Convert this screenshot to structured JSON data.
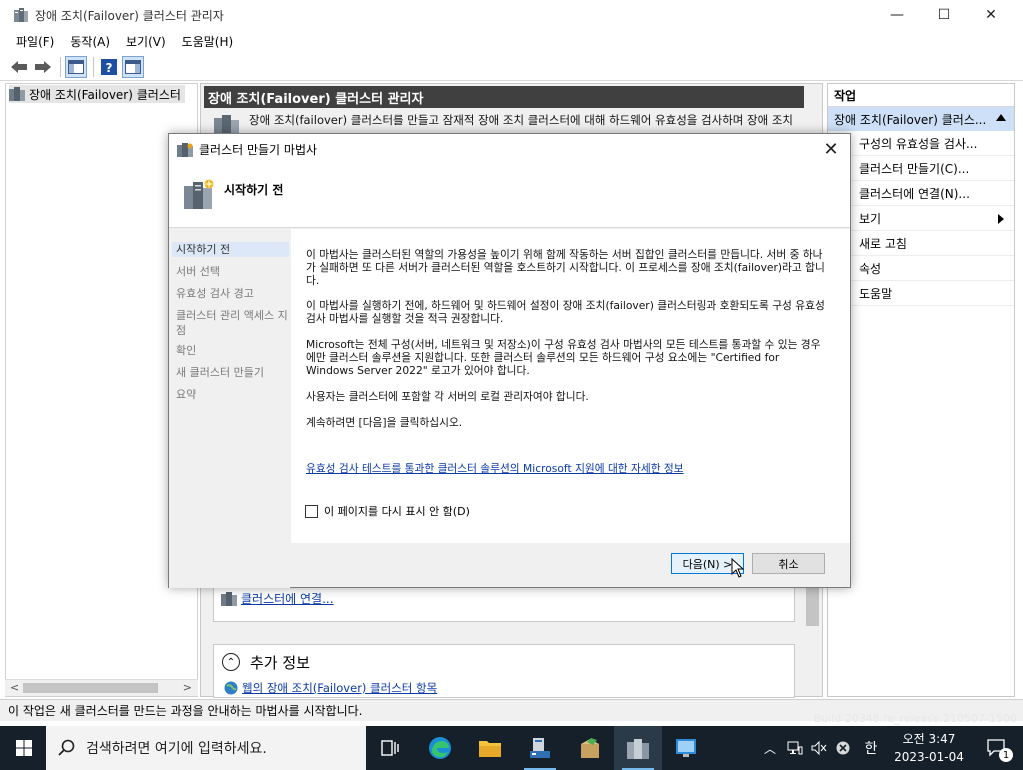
{
  "window": {
    "title": "장애 조치(Failover) 클러스터 관리자",
    "minimize": "—",
    "maximize": "☐",
    "close": "✕"
  },
  "menu": [
    "파일(F)",
    "동작(A)",
    "보기(V)",
    "도움말(H)"
  ],
  "tree": {
    "root_label": "장애 조치(Failover) 클러스터"
  },
  "center": {
    "header": "장애 조치(Failover) 클러스터 관리자",
    "description": "장애 조치(failover) 클러스터를 만들고 잠재적 장애 조치 클러스터에 대해 하드웨어 유효성을 검사하며 장애 조치",
    "connect_link": "클러스터에 연결...",
    "more_info_title": "추가 정보",
    "more_info_link": "웹의 장애 조치(Failover) 클러스터 항목"
  },
  "actions": {
    "header": "작업",
    "sub_header": "장애 조치(Failover) 클러스...",
    "items": [
      "구성의 유효성을 검사...",
      "클러스터 만들기(C)...",
      "클러스터에 연결(N)...",
      "보기",
      "새로 고침",
      "속성",
      "도움말"
    ]
  },
  "status_bar": "이 작업은 새 클러스터를 만드는 과정을 안내하는 마법사를 시작합니다.",
  "build_text": "Build 20348.fe_release.210507-1500",
  "dialog": {
    "title": "클러스터 만들기 마법사",
    "heading": "시작하기 전",
    "steps": [
      "시작하기 전",
      "서버 선택",
      "유효성 검사 경고",
      "클러스터 관리 액세스 지점",
      "확인",
      "새 클러스터 만들기",
      "요약"
    ],
    "paragraphs": [
      "이 마법사는 클러스터된 역할의 가용성을 높이기 위해 함께 작동하는 서버 집합인 클러스터를 만듭니다. 서버 중 하나가 실패하면 또 다른 서버가 클러스터된 역할을 호스트하기 시작합니다. 이 프로세스를 장애 조치(failover)라고 합니다.",
      "이 마법사를 실행하기 전에, 하드웨어 및 하드웨어 설정이 장애 조치(failover) 클러스터링과 호환되도록 구성 유효성 검사 마법사를 실행할 것을 적극 권장합니다.",
      "Microsoft는 전체 구성(서버, 네트워크 및 저장소)이 구성 유효성 검사 마법사의 모든 테스트를 통과할 수 있는 경우에만 클러스터 솔루션을 지원합니다. 또한 클러스터 솔루션의 모든 하드웨어 구성 요소에는 \"Certified for Windows Server 2022\" 로고가 있어야 합니다.",
      "사용자는 클러스터에 포함할 각 서버의 로컬 관리자여야 합니다.",
      "계속하려면 [다음]을 클릭하십시오."
    ],
    "support_link": "유효성 검사 테스트를 통과한 클러스터 솔루션의 Microsoft 지원에 대한 자세한 정보",
    "checkbox_label": "이 페이지를 다시 표시 안 함(D)",
    "next_button": "다음(N) >",
    "cancel_button": "취소"
  },
  "taskbar": {
    "search_placeholder": "검색하려면 여기에 입력하세요.",
    "time": "오전 3:47",
    "date": "2023-01-04",
    "ime": "한",
    "notification_count": "1"
  }
}
